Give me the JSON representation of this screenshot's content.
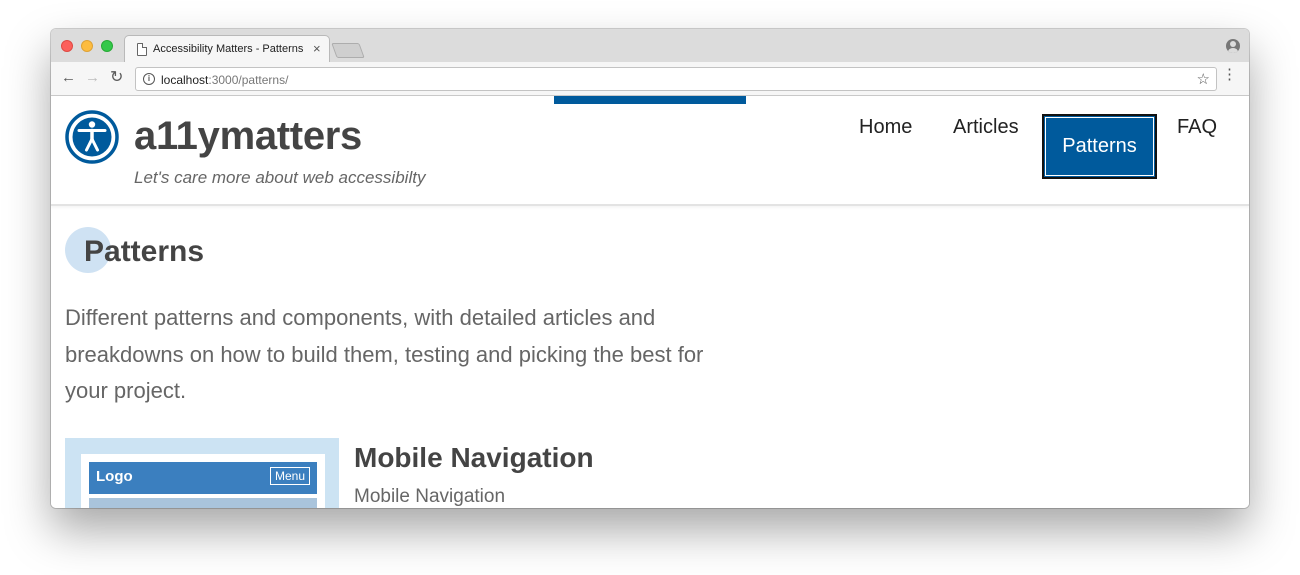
{
  "browser": {
    "tab": {
      "title": "Accessibility Matters - Patterns",
      "close_label": "×"
    },
    "toolbar": {
      "back_glyph": "←",
      "forward_glyph": "→",
      "reload_glyph": "↻",
      "info_glyph": "i",
      "url_host": "localhost",
      "url_path": ":3000/patterns/",
      "star_glyph": "☆",
      "menu_glyph": "⋮"
    }
  },
  "site": {
    "name": "a11ymatters",
    "tagline": "Let's care more about web accessibilty",
    "brand_color": "#005a9c",
    "nav": {
      "home": "Home",
      "articles": "Articles",
      "patterns": "Patterns",
      "faq": "FAQ",
      "active": "Patterns"
    }
  },
  "main": {
    "title": "Patterns",
    "intro": "Different patterns and components, with detailed articles and breakdowns on how to build them, testing and picking the best for your project.",
    "cards": [
      {
        "title": "Mobile Navigation",
        "subtitle": "Mobile Navigation",
        "thumb_logo": "Logo",
        "thumb_menu": "Menu"
      }
    ]
  }
}
